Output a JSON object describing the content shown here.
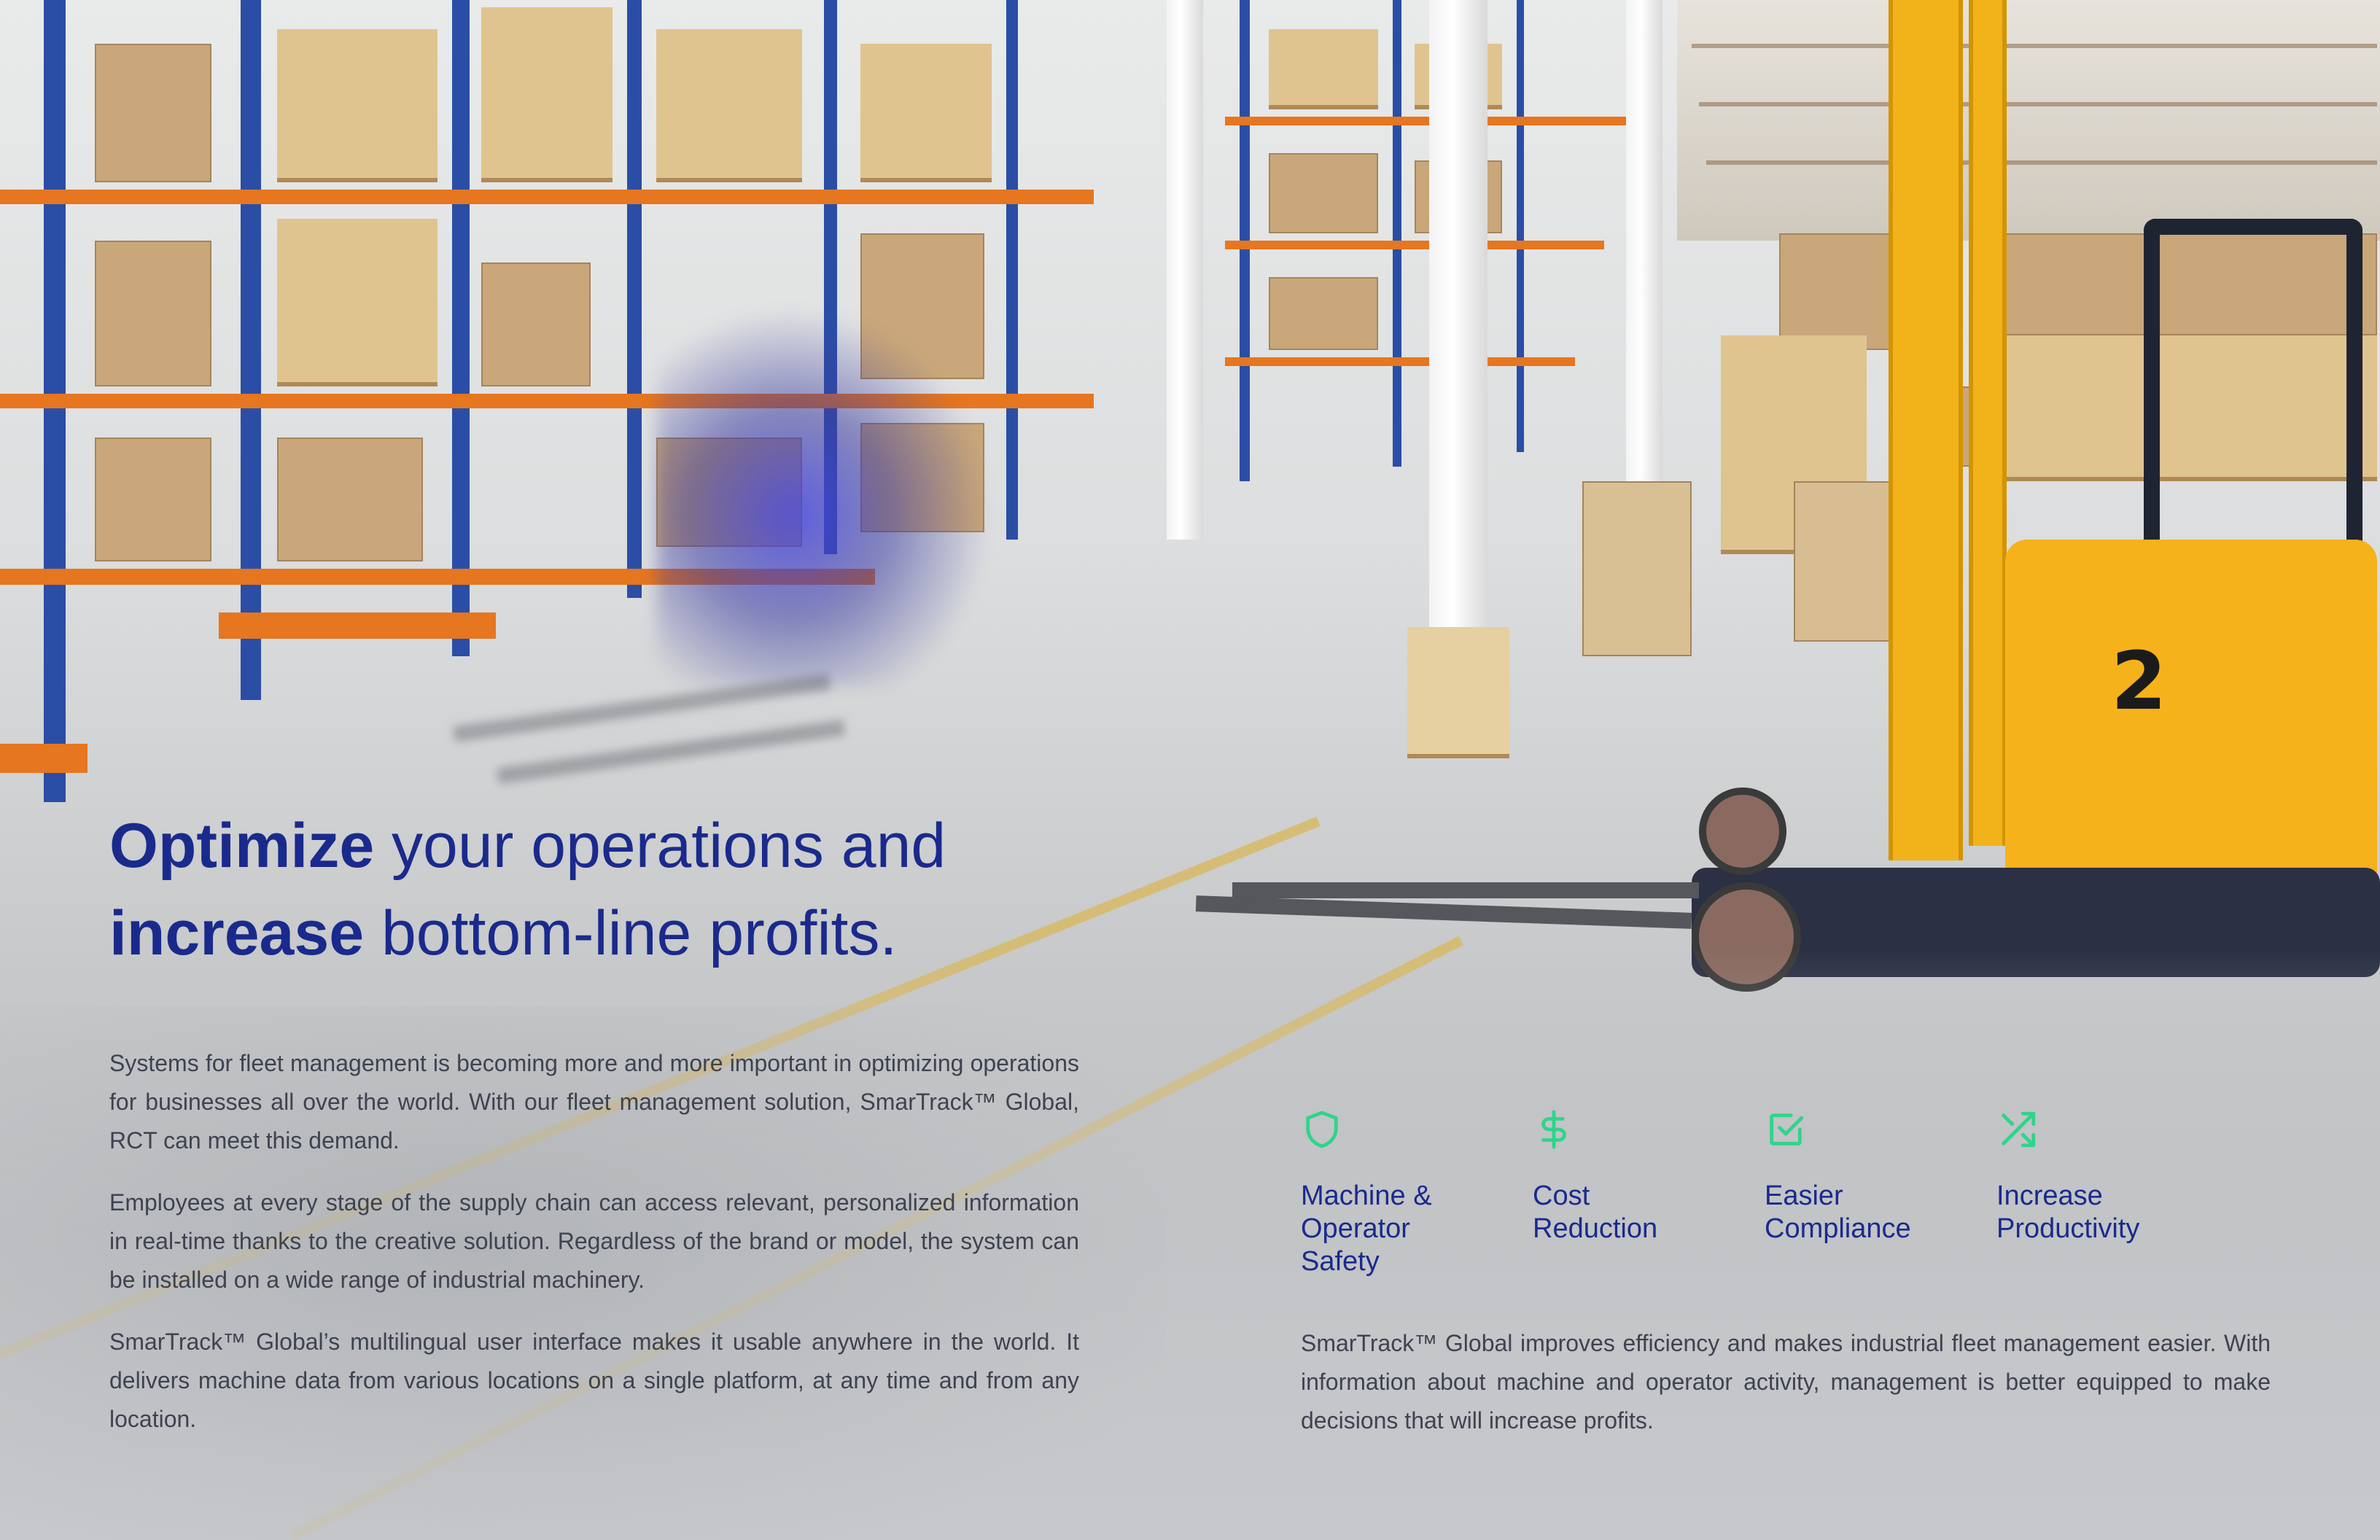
{
  "headline": {
    "line1_bold": "Optimize",
    "line1_rest": " your operations and",
    "line2_bold": "increase",
    "line2_rest": " bottom-line profits."
  },
  "body_left": {
    "paragraphs": [
      "Systems for fleet management is becoming more and more important in optimizing operations for businesses all over the world. With our fleet management solution, SmarTrack™ Global, RCT can meet this demand.",
      "Employees at every stage of the supply chain can access relevant, personalized information in real-time thanks to the creative solution. Regardless of the brand or model, the system can be installed on a wide range of industrial machinery.",
      "SmarTrack™ Global’s multilingual user interface makes it usable anywhere in the world. It delivers machine data from various locations on a single platform, at any time and from any location."
    ]
  },
  "features": [
    {
      "icon": "shield-icon",
      "label": "Machine &\nOperator\nSafety"
    },
    {
      "icon": "dollar-icon",
      "label": "Cost\nReduction"
    },
    {
      "icon": "checkbox-icon",
      "label": "Easier\nCompliance"
    },
    {
      "icon": "shuffle-icon",
      "label": "Increase\nProductivity"
    }
  ],
  "body_right": "SmarTrack™ Global improves efficiency and makes industrial fleet management easier. With information about machine and operator activity, management is better equipped to make decisions that will increase profits.",
  "forklift_number": "2",
  "colors": {
    "headline": "#1a2a8c",
    "body_text": "#3e4350",
    "icon_accent": "#2fd48a",
    "forklift_yellow": "#f5b21b",
    "rack_orange": "#e6761f",
    "rack_blue": "#2a4ea6"
  }
}
